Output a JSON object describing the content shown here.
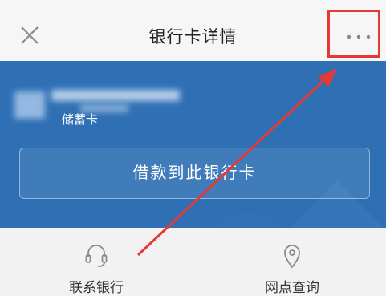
{
  "header": {
    "title": "银行卡详情",
    "close_icon": "close-icon",
    "more_icon": "more-dots-icon"
  },
  "card": {
    "type_label": "储蓄卡",
    "borrow_button_label": "借款到此银行卡"
  },
  "actions": [
    {
      "label": "联系银行",
      "icon": "headset-icon"
    },
    {
      "label": "网点查询",
      "icon": "location-pin-icon"
    }
  ],
  "colors": {
    "card_blue": "#2f6fb4",
    "annotation_red": "#e53935",
    "header_bg": "#f6f6f6"
  }
}
